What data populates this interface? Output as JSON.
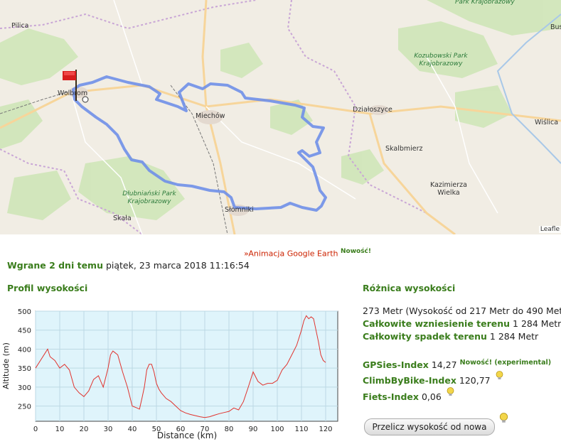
{
  "map": {
    "towns": [
      "Pilica",
      "Wolbrom",
      "Miechów",
      "Działoszyce",
      "Skalbmierz",
      "Kazimierza Wielka",
      "Wiślica",
      "Słomniki",
      "Skała",
      "Bus"
    ],
    "parks": [
      "Park Krajobrazowy",
      "Kozubowski Park Krajobrazowy",
      "Dłubniański Park Krajobrazowy"
    ],
    "attribution": "Leafle",
    "route_color": "#6f8fe8"
  },
  "upload": {
    "label": "Wgrane 2 dni temu",
    "date": "piątek, 23 marca 2018 11:16:54"
  },
  "google_earth": {
    "label": "»Animacja Google Earth",
    "new": "Nowość!"
  },
  "profile": {
    "title": "Profil wysokości"
  },
  "elevation": {
    "title": "Różnica wysokości",
    "diff": "273 Metr (Wysokość od 217 Metr do 490 Metr",
    "ascent_label": "Całkowite wzniesienie terenu",
    "ascent_value": "1 284 Metr",
    "descent_label": "Całkowity spadek terenu",
    "descent_value": "1 284 Metr",
    "gpsies_label": "GPSies-Index",
    "gpsies_value": "14,27",
    "gpsies_note": "Nowość! (experimental)",
    "climb_label": "ClimbByBike-Index",
    "climb_value": "120,77",
    "fiets_label": "Fiets-Index",
    "fiets_value": "0,06"
  },
  "recalc_button": "Przelicz wysokość od nowa",
  "chart_data": {
    "type": "line",
    "xlabel": "Distance (km)",
    "ylabel": "Altitude (m)",
    "xlim": [
      0,
      125
    ],
    "ylim": [
      210,
      500
    ],
    "xticks": [
      0,
      10,
      20,
      30,
      40,
      50,
      60,
      70,
      80,
      90,
      100,
      110,
      120
    ],
    "yticks": [
      250,
      300,
      350,
      400,
      450,
      500
    ],
    "grid": true,
    "series": [
      {
        "color": "#e0332e",
        "x": [
          0,
          2,
          4,
          5,
          6,
          8,
          10,
          12,
          14,
          16,
          18,
          20,
          22,
          24,
          26,
          28,
          30,
          31,
          32,
          33,
          34,
          36,
          38,
          40,
          42,
          43,
          44,
          45,
          46,
          47,
          48,
          49,
          50,
          51,
          52,
          54,
          56,
          58,
          60,
          62,
          64,
          66,
          68,
          70,
          72,
          74,
          76,
          78,
          80,
          82,
          84,
          86,
          88,
          90,
          92,
          94,
          96,
          98,
          100,
          102,
          104,
          106,
          108,
          110,
          111,
          112,
          113,
          114,
          115,
          116,
          117,
          118,
          119,
          120
        ],
        "y": [
          350,
          370,
          390,
          400,
          380,
          370,
          350,
          360,
          345,
          300,
          285,
          275,
          290,
          320,
          330,
          300,
          350,
          385,
          395,
          390,
          385,
          340,
          300,
          250,
          245,
          242,
          270,
          300,
          345,
          360,
          360,
          340,
          310,
          295,
          285,
          270,
          262,
          250,
          238,
          232,
          228,
          225,
          222,
          220,
          222,
          226,
          230,
          233,
          236,
          245,
          240,
          262,
          300,
          340,
          315,
          305,
          310,
          310,
          318,
          345,
          360,
          385,
          410,
          450,
          475,
          488,
          480,
          485,
          480,
          450,
          420,
          385,
          370,
          365
        ]
      }
    ]
  }
}
